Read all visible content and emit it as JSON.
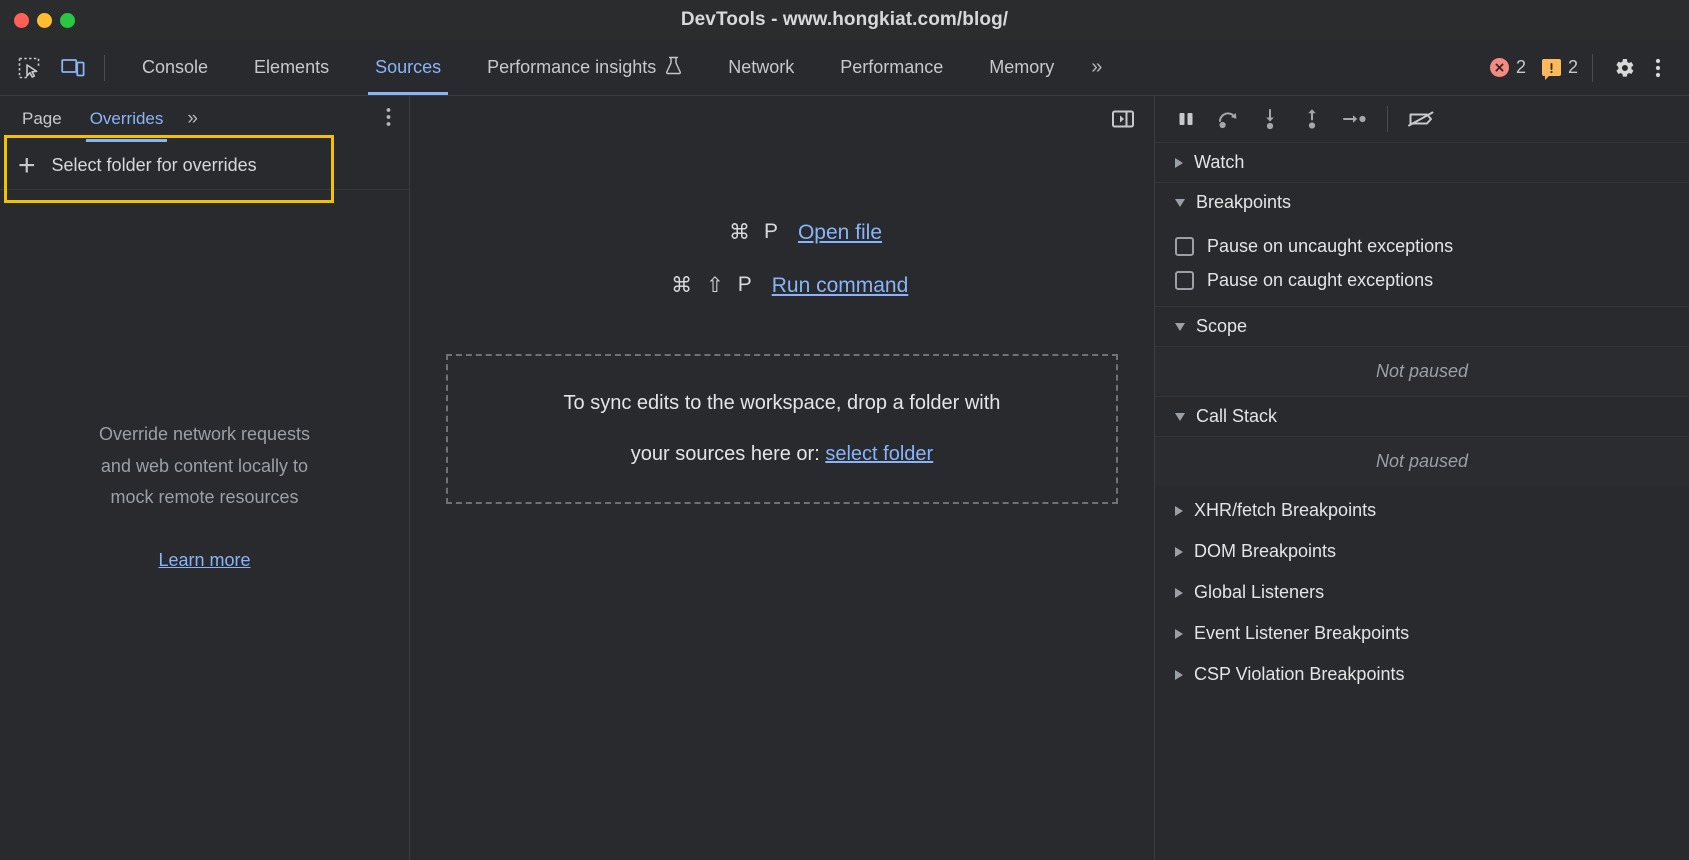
{
  "window": {
    "title": "DevTools - www.hongkiat.com/blog/",
    "traffic_lights": [
      {
        "name": "close",
        "color": "#ff5f57"
      },
      {
        "name": "minimize",
        "color": "#febc2e"
      },
      {
        "name": "maximize",
        "color": "#28c840"
      }
    ]
  },
  "toolbar": {
    "inspect_icon": "inspect-element-icon",
    "device_icon": "device-toolbar-icon",
    "tabs": [
      {
        "label": "Console",
        "active": false
      },
      {
        "label": "Elements",
        "active": false
      },
      {
        "label": "Sources",
        "active": true
      },
      {
        "label": "Performance insights",
        "active": false,
        "icon": "flask-icon"
      },
      {
        "label": "Network",
        "active": false
      },
      {
        "label": "Performance",
        "active": false
      },
      {
        "label": "Memory",
        "active": false
      }
    ],
    "more_tabs_chevron": "»",
    "errors": {
      "count": "2",
      "icon": "error-circle-icon",
      "color": "#f28b82"
    },
    "warnings": {
      "count": "2",
      "icon": "warning-bubble-icon",
      "color": "#fdb95b"
    },
    "settings_icon": "gear-icon",
    "more_options_icon": "kebab-menu-icon"
  },
  "navigator": {
    "tabs": [
      {
        "label": "Page",
        "active": false
      },
      {
        "label": "Overrides",
        "active": true
      }
    ],
    "more_chevron": "»",
    "kebab_icon": "kebab-menu-icon",
    "override_row": {
      "plus": "+",
      "label": "Select folder for overrides",
      "highlighted": true,
      "highlight_color": "#f2c200"
    },
    "empty_state": {
      "line1": "Override network requests",
      "line2": "and web content locally to",
      "line3": "mock remote resources",
      "learn_more": "Learn more"
    }
  },
  "editor": {
    "collapse_sidebar_icon": "show-navigator-icon",
    "shortcuts": [
      {
        "keys": [
          "⌘",
          "P"
        ],
        "label": "Open file"
      },
      {
        "keys": [
          "⌘",
          "⇧",
          "P"
        ],
        "label": "Run command"
      }
    ],
    "dropzone": {
      "text_before": "To sync edits to the workspace, drop a folder with",
      "text_line2": "your sources here or:",
      "link": "select folder"
    }
  },
  "debugger": {
    "controls": [
      {
        "name": "pause-script-execution",
        "icon": "pause-icon"
      },
      {
        "name": "step-over-next-function-call",
        "icon": "step-over-icon"
      },
      {
        "name": "step-into-next-function-call",
        "icon": "step-into-icon"
      },
      {
        "name": "step-out-of-current-function",
        "icon": "step-out-icon"
      },
      {
        "name": "step",
        "icon": "step-icon"
      },
      {
        "name": "deactivate-breakpoints",
        "icon": "deactivate-breakpoints-icon"
      }
    ],
    "sections": [
      {
        "label": "Watch",
        "expanded": false
      },
      {
        "label": "Breakpoints",
        "expanded": true
      }
    ],
    "breakpoint_options": [
      {
        "label": "Pause on uncaught exceptions",
        "checked": false
      },
      {
        "label": "Pause on caught exceptions",
        "checked": false
      }
    ],
    "scope": {
      "label": "Scope",
      "expanded": true,
      "status": "Not paused"
    },
    "call_stack": {
      "label": "Call Stack",
      "expanded": true,
      "status": "Not paused"
    },
    "collapsed_sections": [
      {
        "label": "XHR/fetch Breakpoints"
      },
      {
        "label": "DOM Breakpoints"
      },
      {
        "label": "Global Listeners"
      },
      {
        "label": "Event Listener Breakpoints"
      },
      {
        "label": "CSP Violation Breakpoints"
      }
    ]
  }
}
